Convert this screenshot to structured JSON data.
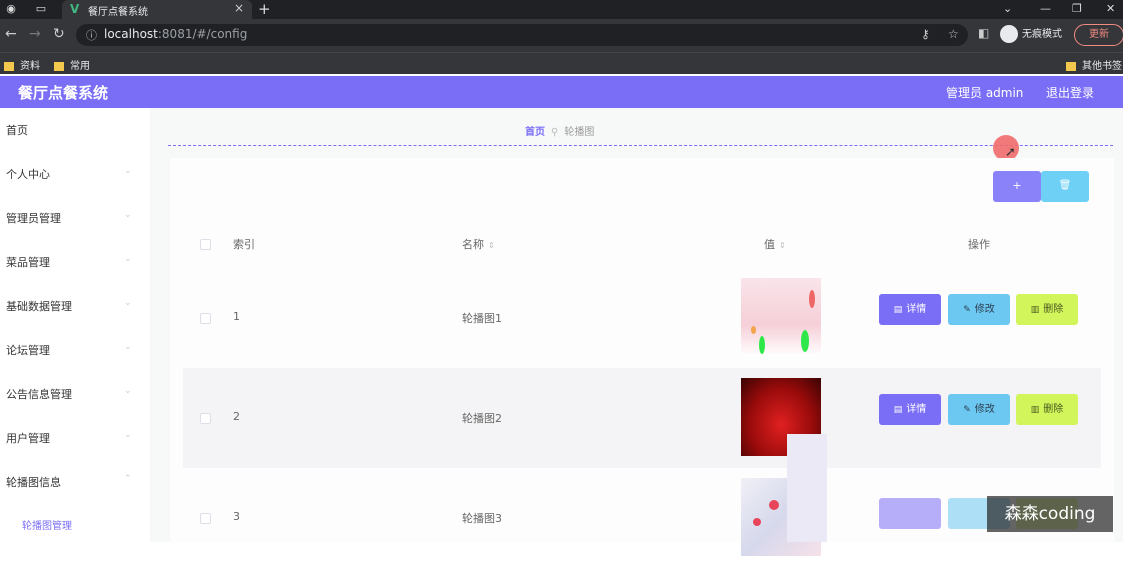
{
  "browser": {
    "tab_title": "餐厅点餐系统",
    "tab_close": "×",
    "new_tab": "+",
    "url_host": "localhost",
    "url_path": ":8081/#/config",
    "incognito_label": "无痕模式",
    "update_label": "更新",
    "bookmarks": [
      "资料",
      "常用"
    ],
    "other_bookmarks": "其他书签"
  },
  "header": {
    "title": "餐厅点餐系统",
    "admin_label": "管理员 admin",
    "logout_label": "退出登录",
    "accent": "#7b6ef6"
  },
  "sidebar": {
    "items": [
      {
        "label": "首页"
      },
      {
        "label": "个人中心"
      },
      {
        "label": "管理员管理"
      },
      {
        "label": "菜品管理"
      },
      {
        "label": "基础数据管理"
      },
      {
        "label": "论坛管理"
      },
      {
        "label": "公告信息管理"
      },
      {
        "label": "用户管理"
      },
      {
        "label": "轮播图信息"
      }
    ],
    "sub_item": "轮播图管理"
  },
  "breadcrumb": {
    "home": "首页",
    "current": "轮播图"
  },
  "toolbar": {
    "add_label": "+",
    "delete_icon": "🗑"
  },
  "table": {
    "columns": [
      "索引",
      "名称",
      "值",
      "操作"
    ],
    "sort_icon": "⇕",
    "rows": [
      {
        "index": "1",
        "name": "轮播图1"
      },
      {
        "index": "2",
        "name": "轮播图2"
      },
      {
        "index": "3",
        "name": "轮播图3"
      }
    ],
    "actions": {
      "detail": "详情",
      "edit": "修改",
      "delete": "删除"
    }
  },
  "watermark": "森森coding"
}
